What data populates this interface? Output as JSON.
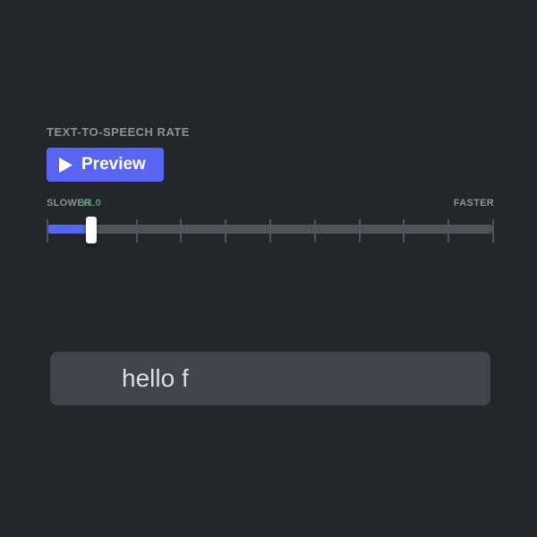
{
  "tts": {
    "header": "TEXT-TO-SPEECH RATE",
    "preview_label": "Preview",
    "slower_label": "SLOWER",
    "faster_label": "FASTER",
    "value_display": "x1.0",
    "slider": {
      "min": 0,
      "max": 10,
      "value": 1,
      "ticks": 11
    }
  },
  "input": {
    "value": "hello f",
    "placeholder": ""
  },
  "colors": {
    "accent": "#5865f2",
    "success": "#3ba55d",
    "track": "#4f545c",
    "bg": "#23272a",
    "input_bg": "#40444b"
  }
}
